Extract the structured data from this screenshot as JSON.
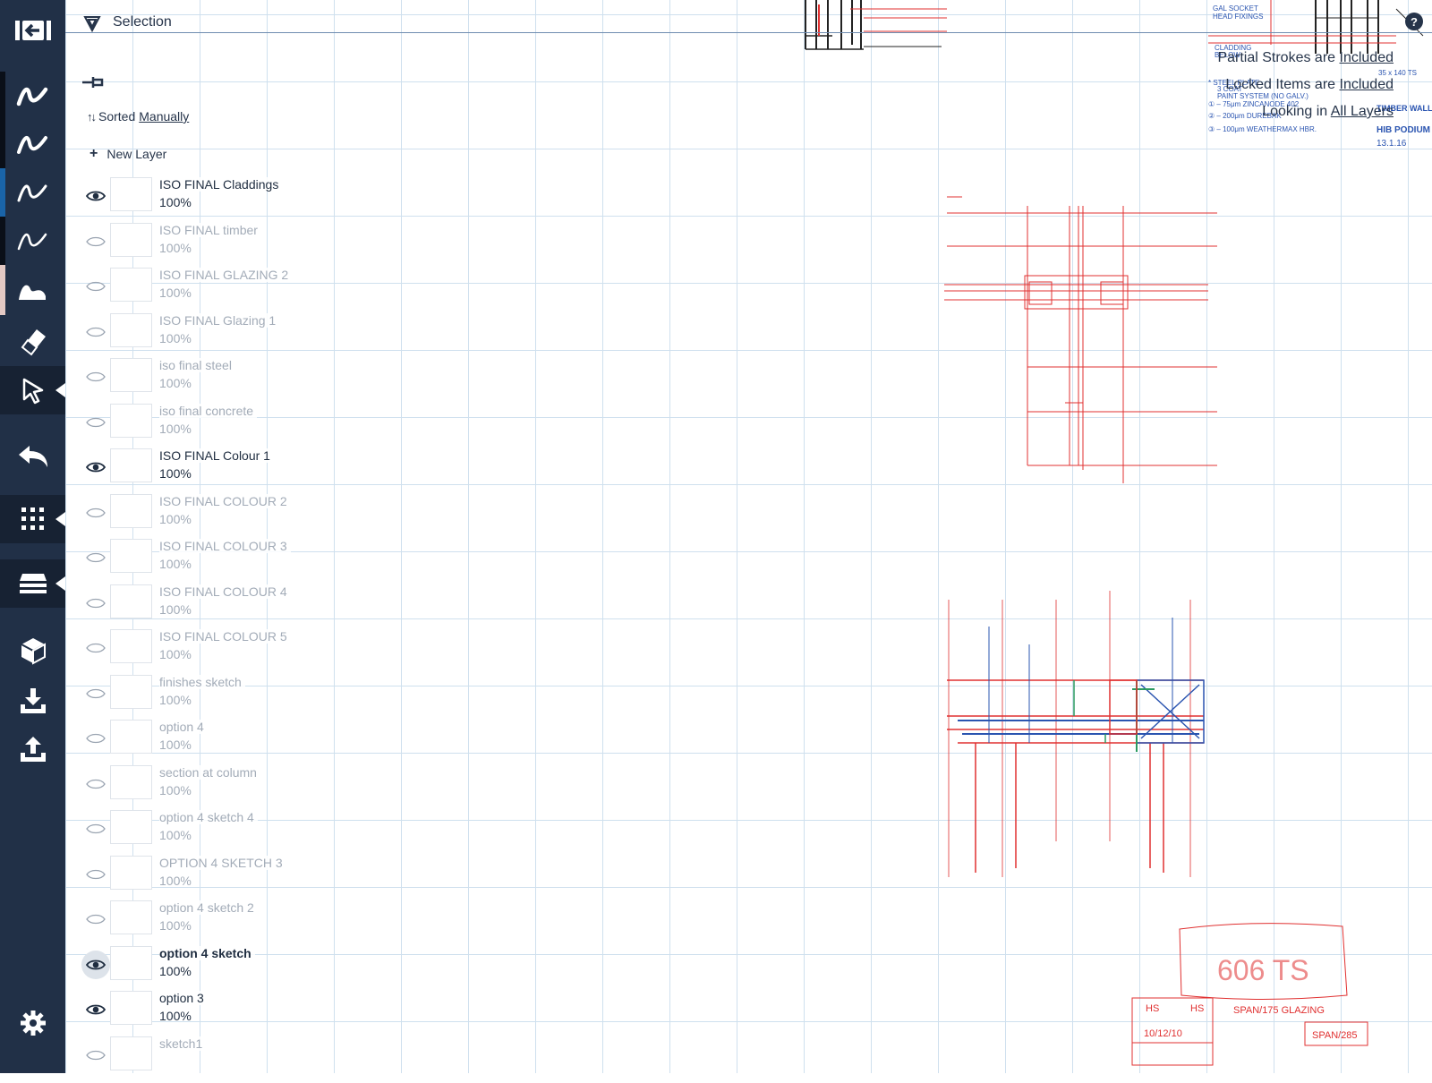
{
  "panel": {
    "title": "Selection",
    "sort_label": "Sorted",
    "sort_value": "Manually",
    "new_layer_label": "New Layer"
  },
  "layers": [
    {
      "name": "ISO FINAL Claddings",
      "opacity": "100%",
      "visible": true,
      "selected": false
    },
    {
      "name": "ISO FINAL timber",
      "opacity": "100%",
      "visible": false,
      "selected": false
    },
    {
      "name": "ISO FINAL GLAZING 2",
      "opacity": "100%",
      "visible": false,
      "selected": false
    },
    {
      "name": "ISO FINAL Glazing 1",
      "opacity": "100%",
      "visible": false,
      "selected": false
    },
    {
      "name": "iso final steel",
      "opacity": "100%",
      "visible": false,
      "selected": false
    },
    {
      "name": "iso final concrete",
      "opacity": "100%",
      "visible": false,
      "selected": false
    },
    {
      "name": "ISO FINAL Colour 1",
      "opacity": "100%",
      "visible": true,
      "selected": false
    },
    {
      "name": "ISO FINAL COLOUR 2",
      "opacity": "100%",
      "visible": false,
      "selected": false
    },
    {
      "name": "ISO FINAL COLOUR 3",
      "opacity": "100%",
      "visible": false,
      "selected": false
    },
    {
      "name": "ISO FINAL COLOUR 4",
      "opacity": "100%",
      "visible": false,
      "selected": false
    },
    {
      "name": "ISO FINAL COLOUR 5",
      "opacity": "100%",
      "visible": false,
      "selected": false
    },
    {
      "name": "finishes sketch",
      "opacity": "100%",
      "visible": false,
      "selected": false
    },
    {
      "name": "option 4",
      "opacity": "100%",
      "visible": false,
      "selected": false
    },
    {
      "name": "section at column",
      "opacity": "100%",
      "visible": false,
      "selected": false
    },
    {
      "name": "option 4 sketch 4",
      "opacity": "100%",
      "visible": false,
      "selected": false
    },
    {
      "name": "OPTION 4 SKETCH 3",
      "opacity": "100%",
      "visible": false,
      "selected": false
    },
    {
      "name": "option 4 sketch 2",
      "opacity": "100%",
      "visible": false,
      "selected": false
    },
    {
      "name": "option 4 sketch",
      "opacity": "100%",
      "visible": true,
      "selected": true
    },
    {
      "name": "option 3",
      "opacity": "100%",
      "visible": true,
      "selected": false
    },
    {
      "name": "sketch1",
      "opacity": "",
      "visible": false,
      "selected": false
    }
  ],
  "selection_info": {
    "partial_label": "Partial Strokes are",
    "partial_value": "Included",
    "locked_label": "Locked Items are",
    "locked_value": "Included",
    "looking_label": "Looking in",
    "looking_value": "All Layers",
    "help_symbol": "?"
  },
  "toolbar": {
    "items": [
      "back-to-gallery",
      "pen-1",
      "pen-2",
      "pen-3",
      "pen-4",
      "brush",
      "eraser",
      "selection",
      "undo",
      "grid",
      "layers",
      "3d-object",
      "import",
      "export",
      "settings"
    ],
    "active": [
      "selection",
      "grid",
      "layers"
    ]
  },
  "colors": {
    "toolbar_bg": "#213047",
    "toolbar_active": "#172233",
    "accent_blue": "#1a64a8",
    "sketch_red": "#e03030",
    "sketch_blue": "#2a54b0",
    "sketch_green": "#2a9a60",
    "grid_line": "#cfe0ee"
  },
  "sketch_annotations": {
    "top_right": [
      "GAL SOCKET",
      "HEAD FIXINGS",
      "CLADDING",
      "BELOW",
      "* STEEL PLATE",
      "3 COAT",
      "PAINT SYSTEM (NO GALV.)",
      "① – 75μm ZINCANODE 402",
      "② – 200μm DUREBAK",
      "③ – 100μm WEATHERMAX HBR.",
      "35 x 140 TS",
      "TIMBER WALLS",
      "HIB PODIUM F",
      "13.1.16"
    ],
    "bottom_right": [
      "606 TS",
      "HS",
      "HS",
      "SPAN/175 GLAZING",
      "10/12/10",
      "SPAN/285"
    ]
  }
}
